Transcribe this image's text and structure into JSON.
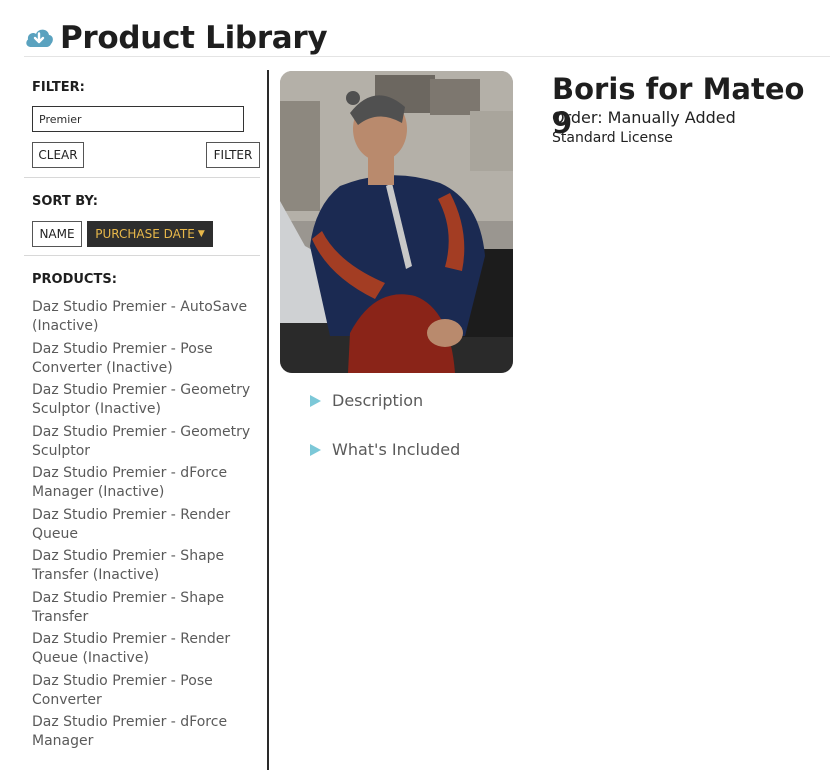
{
  "header": {
    "title": "Product Library",
    "icon": "cloud-download-icon",
    "accent": "#5aa2bf"
  },
  "filter": {
    "label": "FILTER:",
    "value": "Premier",
    "clear_label": "CLEAR",
    "filter_label": "FILTER"
  },
  "sort": {
    "label": "SORT BY:",
    "name_label": "NAME",
    "purchase_date_label": "PURCHASE DATE",
    "active": "PURCHASE DATE",
    "active_bg": "#2e2e2e",
    "active_fg": "#e8b84a"
  },
  "products": {
    "label": "PRODUCTS:",
    "items": [
      "Daz Studio Premier - AutoSave (Inactive)",
      "Daz Studio Premier - Pose Converter (Inactive)",
      "Daz Studio Premier - Geometry Sculptor (Inactive)",
      "Daz Studio Premier - Geometry Sculptor",
      "Daz Studio Premier - dForce Manager (Inactive)",
      "Daz Studio Premier - Render Queue",
      "Daz Studio Premier - Shape Transfer (Inactive)",
      "Daz Studio Premier - Shape Transfer",
      "Daz Studio Premier - Render Queue (Inactive)",
      "Daz Studio Premier - Pose Converter",
      "Daz Studio Premier - dForce Manager"
    ]
  },
  "detail": {
    "title": "Boris for Mateo 9",
    "order": "Order: Manually Added",
    "license": "Standard License",
    "sections": [
      "Description",
      "What's Included"
    ],
    "section_icon": "expand-triangle-icon",
    "section_icon_color": "#7cc8d8"
  }
}
